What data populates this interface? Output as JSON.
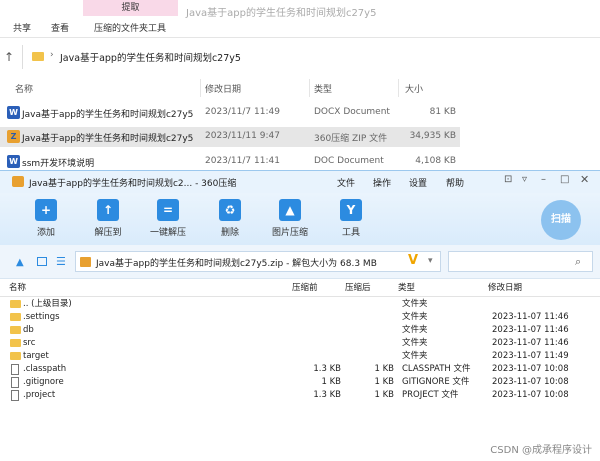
{
  "explorer": {
    "ribbon": {
      "tab1": "共享",
      "tab2": "查看",
      "context_group": "提取",
      "context_tab": "压缩的文件夹工具"
    },
    "window_title": "Java基于app的学生任务和时间规划c27y5",
    "address": "Java基于app的学生任务和时间规划c27y5",
    "columns": {
      "name": "名称",
      "date": "修改日期",
      "type": "类型",
      "size": "大小"
    },
    "files": [
      {
        "icon": "W",
        "name": "Java基于app的学生任务和时间规划c27y5",
        "date": "2023/11/7 11:49",
        "type": "DOCX Document",
        "size": "81 KB"
      },
      {
        "icon": "Z",
        "name": "Java基于app的学生任务和时间规划c27y5",
        "date": "2023/11/11 9:47",
        "type": "360压缩 ZIP 文件",
        "size": "34,935 KB"
      },
      {
        "icon": "W",
        "name": "ssm开发环境说明",
        "date": "2023/11/7 11:41",
        "type": "DOC Document",
        "size": "4,108 KB"
      }
    ]
  },
  "zip": {
    "title": "Java基于app的学生任务和时间规划c2... - 360压缩",
    "menu": [
      "文件",
      "操作",
      "设置",
      "帮助"
    ],
    "toolbar": [
      {
        "icon": "plus-icon",
        "glyph": "+",
        "label": "添加"
      },
      {
        "icon": "extract-icon",
        "glyph": "↑",
        "label": "解压到"
      },
      {
        "icon": "one-click-icon",
        "glyph": "=",
        "label": "一键解压"
      },
      {
        "icon": "trash-icon",
        "glyph": "♻",
        "label": "删除"
      },
      {
        "icon": "image-icon",
        "glyph": "▲",
        "label": "图片压缩"
      },
      {
        "icon": "tools-icon",
        "glyph": "Y",
        "label": "工具"
      }
    ],
    "scan_label": "扫描",
    "path": "Java基于app的学生任务和时间规划c27y5.zip - 解包大小为 68.3 MB",
    "columns": {
      "name": "名称",
      "packed": "压缩前",
      "unpacked": "压缩后",
      "type": "类型",
      "date": "修改日期"
    },
    "items": [
      {
        "kind": "folder",
        "name": ".. (上级目录)",
        "packed": "",
        "unpacked": "",
        "type": "文件夹",
        "date": ""
      },
      {
        "kind": "folder",
        "name": ".settings",
        "packed": "",
        "unpacked": "",
        "type": "文件夹",
        "date": "2023-11-07 11:46"
      },
      {
        "kind": "folder",
        "name": "db",
        "packed": "",
        "unpacked": "",
        "type": "文件夹",
        "date": "2023-11-07 11:46"
      },
      {
        "kind": "folder",
        "name": "src",
        "packed": "",
        "unpacked": "",
        "type": "文件夹",
        "date": "2023-11-07 11:46"
      },
      {
        "kind": "folder",
        "name": "target",
        "packed": "",
        "unpacked": "",
        "type": "文件夹",
        "date": "2023-11-07 11:49"
      },
      {
        "kind": "file",
        "name": ".classpath",
        "packed": "1.3 KB",
        "unpacked": "1 KB",
        "type": "CLASSPATH 文件",
        "date": "2023-11-07 10:08"
      },
      {
        "kind": "file",
        "name": ".gitignore",
        "packed": "1 KB",
        "unpacked": "1 KB",
        "type": "GITIGNORE 文件",
        "date": "2023-11-07 10:08"
      },
      {
        "kind": "file",
        "name": ".project",
        "packed": "1.3 KB",
        "unpacked": "1 KB",
        "type": "PROJECT 文件",
        "date": "2023-11-07 10:08"
      }
    ]
  },
  "watermark": "CSDN @成承程序设计",
  "colors": {
    "accent": "#2c8be0",
    "selected_row": "#e6e6e6",
    "context_tab": "#f9d9e8"
  }
}
